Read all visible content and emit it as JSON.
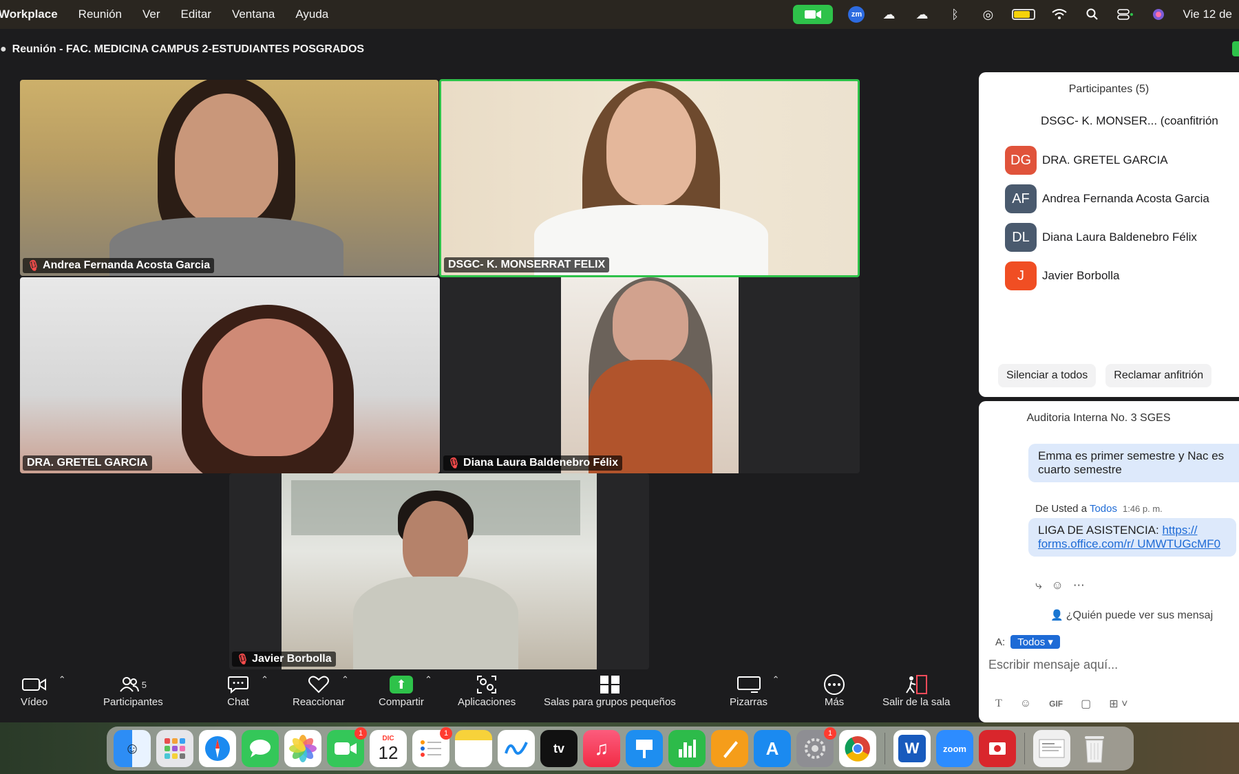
{
  "menubar": {
    "app": "Workplace",
    "items": [
      "Reunión",
      "Ver",
      "Editar",
      "Ventana",
      "Ayuda"
    ],
    "zm": "zm",
    "datetime": "Vie 12 de"
  },
  "window": {
    "title": "Reunión - FAC. MEDICINA CAMPUS 2-ESTUDIANTES POSGRADOS"
  },
  "videos": [
    {
      "name": "Andrea Fernanda Acosta Garcia",
      "muted": true
    },
    {
      "name": "DSGC- K. MONSERRAT FELIX",
      "muted": false,
      "active": true
    },
    {
      "name": "DRA. GRETEL GARCIA",
      "muted": false
    },
    {
      "name": "Diana Laura Baldenebro Félix",
      "muted": true
    },
    {
      "name": "Javier Borbolla",
      "muted": true
    }
  ],
  "participants_panel": {
    "title": "Participantes (5)",
    "host_row": "DSGC- K. MONSER...  (coanfitrión",
    "rows": [
      {
        "initials": "DG",
        "name": "DRA. GRETEL GARCIA",
        "color": "#e0533b"
      },
      {
        "initials": "AF",
        "name": "Andrea Fernanda Acosta Garcia",
        "color": "#4a5a6e"
      },
      {
        "initials": "DL",
        "name": "Diana Laura Baldenebro Félix",
        "color": "#4a5a6e"
      },
      {
        "initials": "J",
        "name": "Javier Borbolla",
        "color": "#f04e23"
      }
    ],
    "mute_all": "Silenciar a todos",
    "claim_host": "Reclamar anfitrión"
  },
  "chat": {
    "title": "Auditoria Interna No. 3 SGES",
    "message1": "Emma es primer semestre y Nac es cuarto semestre",
    "from": "De Usted a",
    "to": "Todos",
    "time": "1:46 p. m.",
    "message2_prefix": "LIGA DE ASISTENCIA:",
    "message2_link": "https:// forms.office.com/r/ UMWTUGcMF0",
    "who_can_see": "¿Quién puede ver sus mensaj",
    "to_label": "A:",
    "recipient": "Todos",
    "input_placeholder": "Escribir mensaje aquí...",
    "gif_label": "GIF"
  },
  "toolbar": {
    "video": "Vídeo",
    "participants": "Participantes",
    "participants_count": "5",
    "chat": "Chat",
    "react": "Reaccionar",
    "share": "Compartir",
    "apps": "Aplicaciones",
    "breakout": "Salas para grupos pequeños",
    "whiteboards": "Pizarras",
    "more": "Más",
    "leave": "Salir de la sala"
  },
  "dock": {
    "facetime_badge": "1",
    "calendar_month": "DIC",
    "calendar_day": "12",
    "reminders_badge": "1",
    "settings_badge": "1",
    "zoom_label": "zoom",
    "word_label": "W",
    "tv_label": "tv"
  },
  "colors": {
    "accent_green": "#2ec24a",
    "link_blue": "#1e6bd6",
    "bubble": "#dde9fb"
  }
}
